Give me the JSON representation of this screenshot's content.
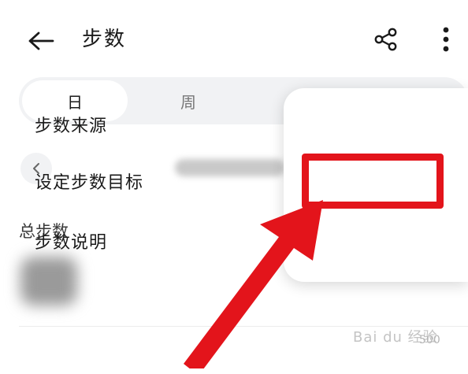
{
  "header": {
    "title": "步数",
    "back_icon": "arrow-left-icon",
    "share_icon": "share-icon",
    "more_icon": "more-vertical-icon"
  },
  "tabs": [
    {
      "label": "日",
      "selected": true
    },
    {
      "label": "周",
      "selected": false
    }
  ],
  "date_nav": {
    "prev_icon": "chevron-left-icon"
  },
  "summary": {
    "total_label": "总步数"
  },
  "menu": {
    "items": [
      {
        "label": "步数来源"
      },
      {
        "label": "设定步数目标",
        "highlighted": true
      },
      {
        "label": "步数说明"
      }
    ]
  },
  "annotation": {
    "highlight_color": "#e3141b",
    "arrow_color": "#e3141b"
  },
  "watermark": {
    "text": "Bai du 经验",
    "sub": "500"
  },
  "colors": {
    "background": "#ffffff",
    "tab_track": "#f1f2f4",
    "text_primary": "#1a1a1a",
    "text_secondary": "#777777"
  }
}
